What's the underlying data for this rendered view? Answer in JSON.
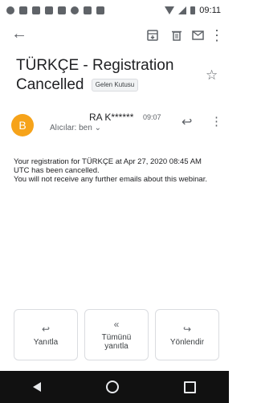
{
  "status_bar": {
    "time": "09:11"
  },
  "subject": {
    "title": "TÜRKÇE - Registration Cancelled",
    "label": "Gelen Kutusu"
  },
  "sender": {
    "avatar_letter": "B",
    "name": "RA K******",
    "time": "09:07",
    "recipient": "Alıcılar: ben ⌄"
  },
  "body": {
    "line1": "Your registration for TÜRKÇE at Apr 27, 2020 08:45 AM UTC has been cancelled.",
    "line2": "You will not receive any further emails about this webinar."
  },
  "actions": {
    "reply": "Yanıtla",
    "reply_all": "Tümünü yanıtla",
    "forward": "Yönlendir"
  },
  "icons": {
    "back": "arrow-left-icon",
    "archive": "archive-icon",
    "delete": "trash-icon",
    "mark_unread": "mail-icon",
    "more": "more-vert-icon",
    "star": "star-icon",
    "reply": "reply-icon"
  },
  "colors": {
    "avatar": "#f6a31a",
    "navbar": "#111111"
  }
}
